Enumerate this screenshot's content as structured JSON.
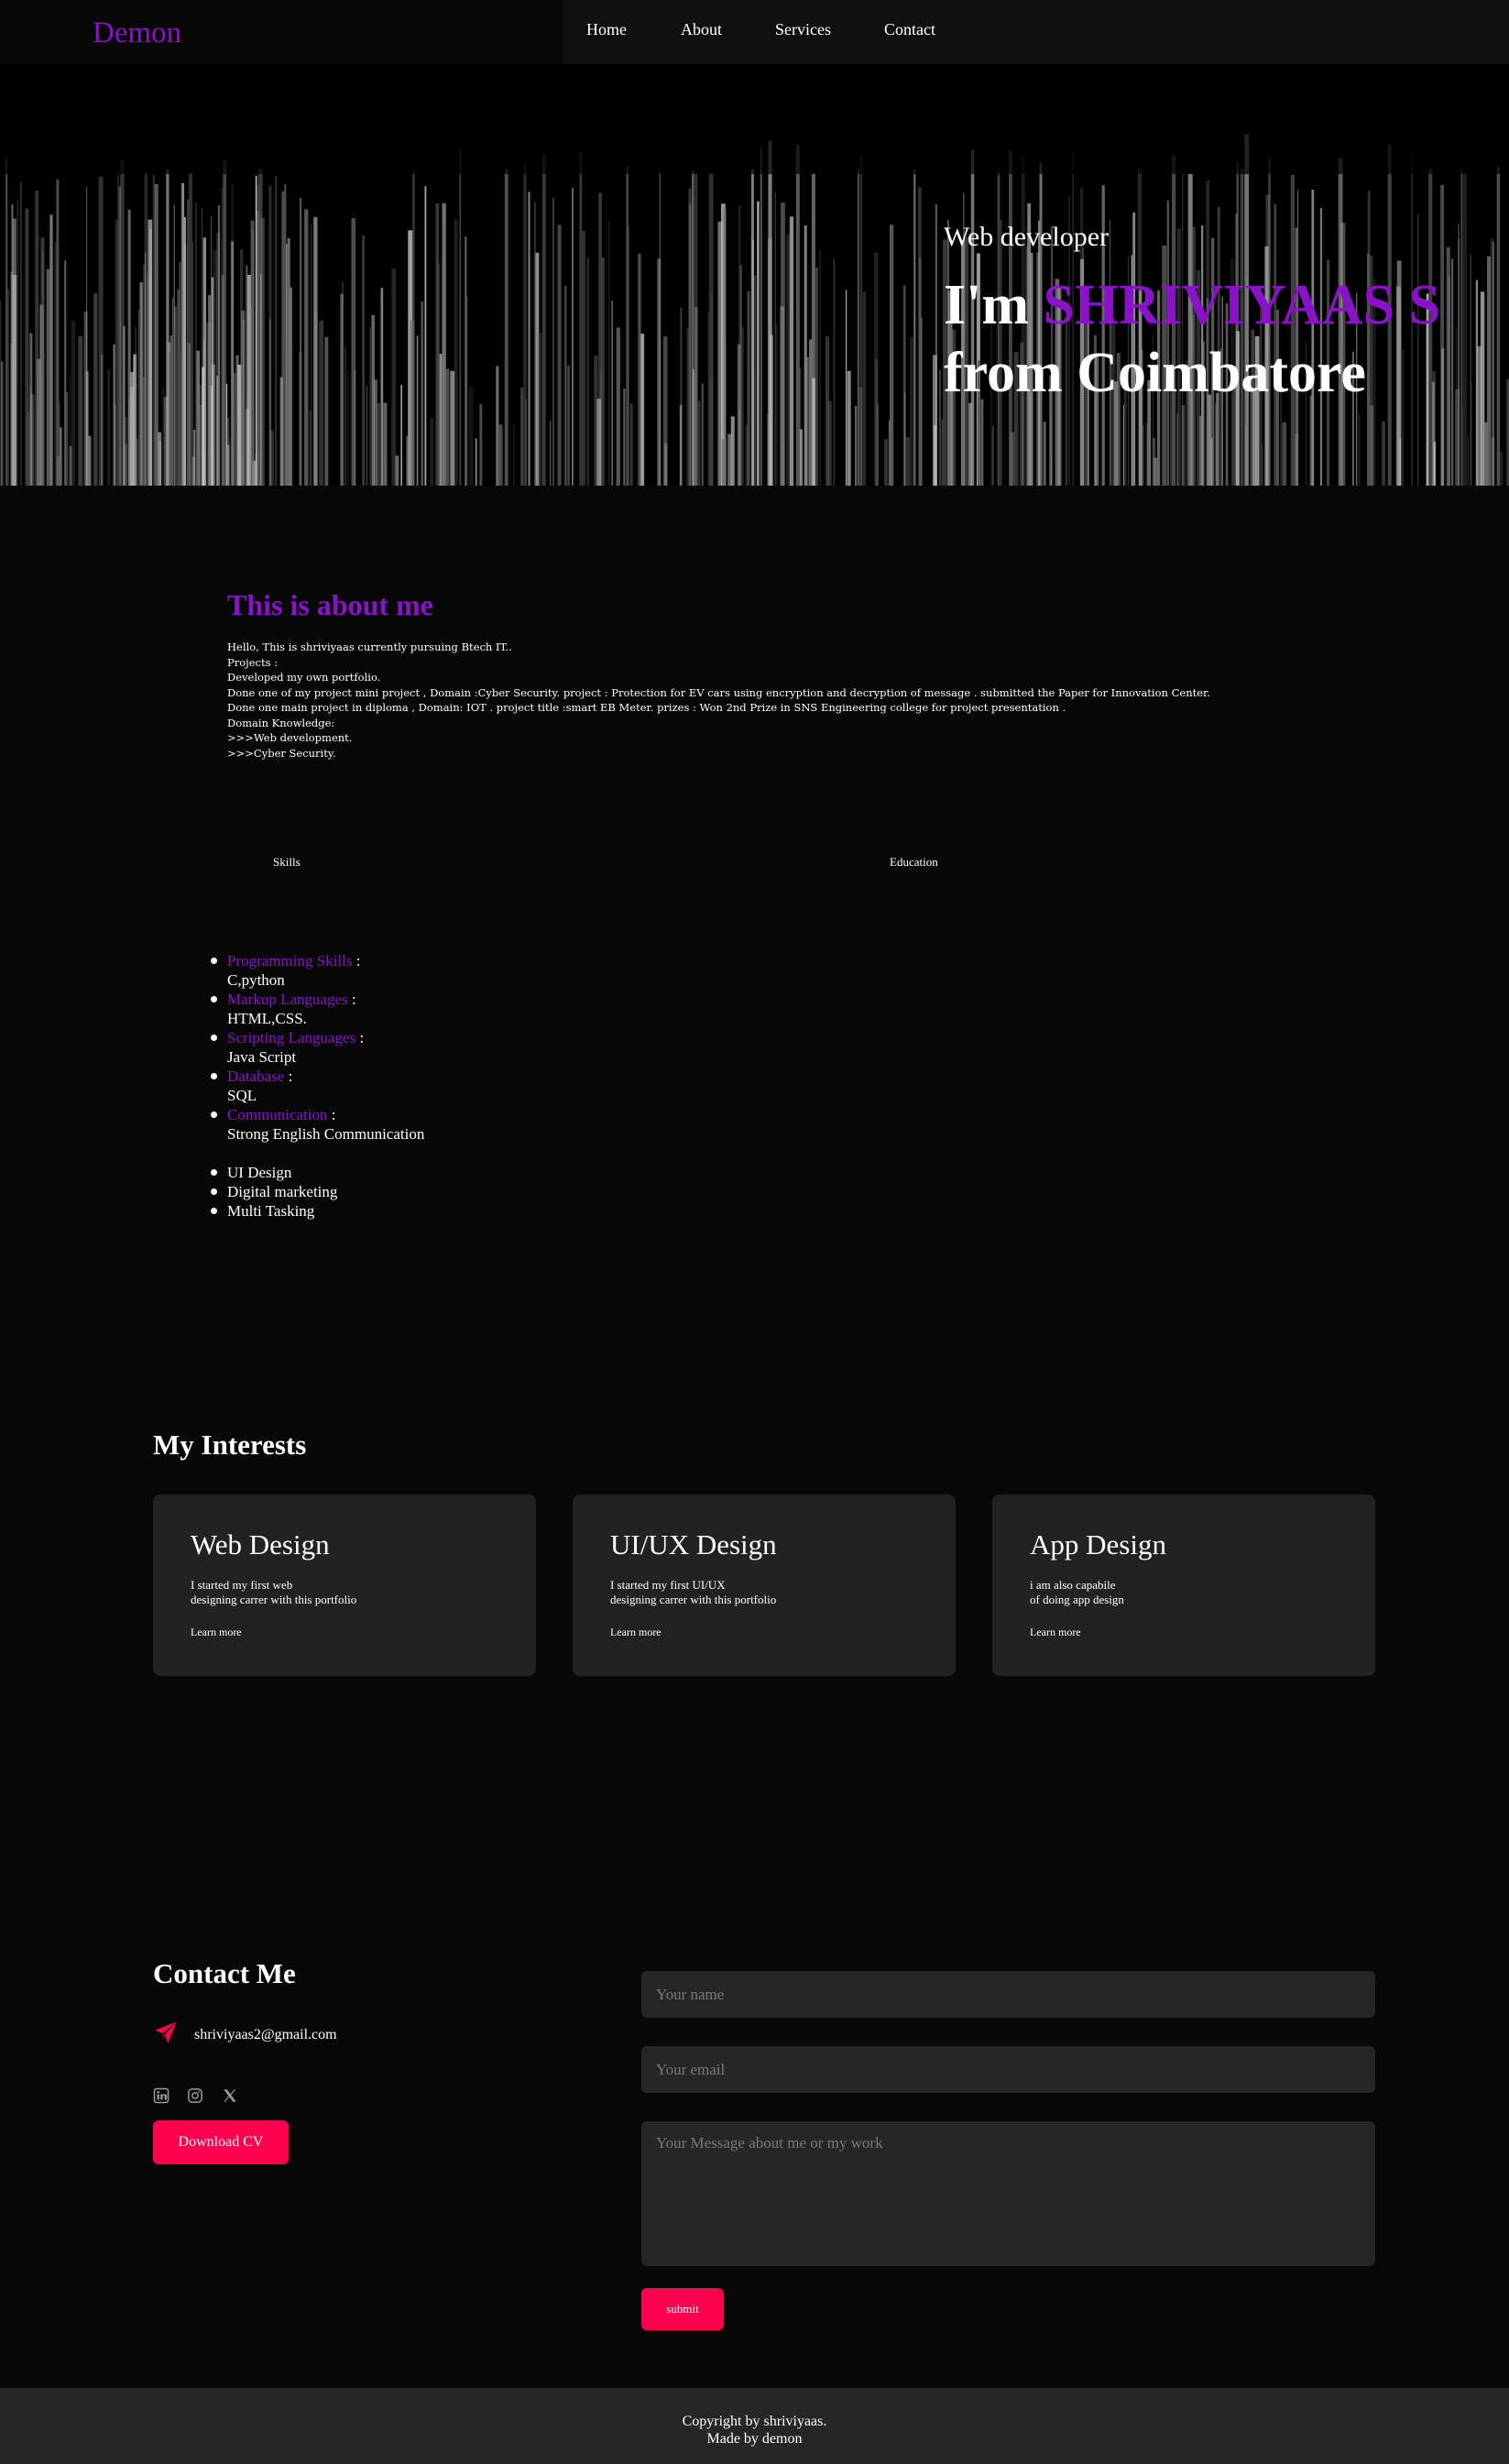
{
  "header": {
    "logo": "Demon",
    "nav": [
      {
        "label": "Home"
      },
      {
        "label": "About"
      },
      {
        "label": "Services"
      },
      {
        "label": "Contact"
      }
    ]
  },
  "hero": {
    "subtitle": "Web developer",
    "title_prefix": "I'm",
    "name": "SHRIVIYAAS S",
    "title_suffix": "from Coimbatore"
  },
  "about": {
    "title": "This is about me",
    "lines": [
      "Hello, This is shriviyaas currently pursuing Btech IT..",
      "",
      "Projects :",
      "Developed my own portfolio.",
      "Done one of my project mini project , Domain :Cyber Security. project : Protection for EV cars using encryption and decryption of message . submitted the Paper for Innovation Center.",
      "Done one main project in diploma , Domain: IOT . project title :smart EB Meter. prizes : Won 2nd Prize in SNS Engineering college for project presentation .",
      "",
      "Domain Knowledge:",
      ">>>Web development.",
      ">>>Cyber Security."
    ],
    "tabs": {
      "skills": "Skills",
      "education": "Education"
    },
    "skills": [
      {
        "category": "Programming Skills",
        "value": "C,python"
      },
      {
        "category": "Markup Languages",
        "value": "HTML,CSS."
      },
      {
        "category": "Scripting Languages",
        "value": "Java Script"
      },
      {
        "category": "Database",
        "value": "SQL"
      },
      {
        "category": "Communication",
        "value": "Strong English Communication"
      }
    ],
    "extra_skills": [
      "UI Design",
      "Digital marketing",
      "Multi Tasking"
    ]
  },
  "interests": {
    "title": "My Interests",
    "cards": [
      {
        "title": "Web Design",
        "text": "I started my first web\ndesigning carrer with this portfolio",
        "link": "Learn more"
      },
      {
        "title": "UI/UX Design",
        "text": "I started my first UI/UX\ndesigning carrer with this portfolio",
        "link": "Learn more"
      },
      {
        "title": "App Design",
        "text": "i am also capabile\nof doing app design",
        "link": "Learn more"
      }
    ]
  },
  "contact": {
    "title": "Contact Me",
    "email": "shriviyaas2@gmail.com",
    "social_icons": [
      "linkedin-icon",
      "instagram-icon",
      "x-icon"
    ],
    "cv_button": "Download CV",
    "form": {
      "name_placeholder": "Your name",
      "email_placeholder": "Your email",
      "message_placeholder": "Your Message about me or my work",
      "submit": "submit"
    }
  },
  "footer": {
    "line1": "Copyright by shriviyaas.",
    "line2": "Made by demon"
  },
  "colors": {
    "accent": "#8a12c9",
    "button": "#ff004f",
    "background": "#080808",
    "card": "#222222"
  }
}
